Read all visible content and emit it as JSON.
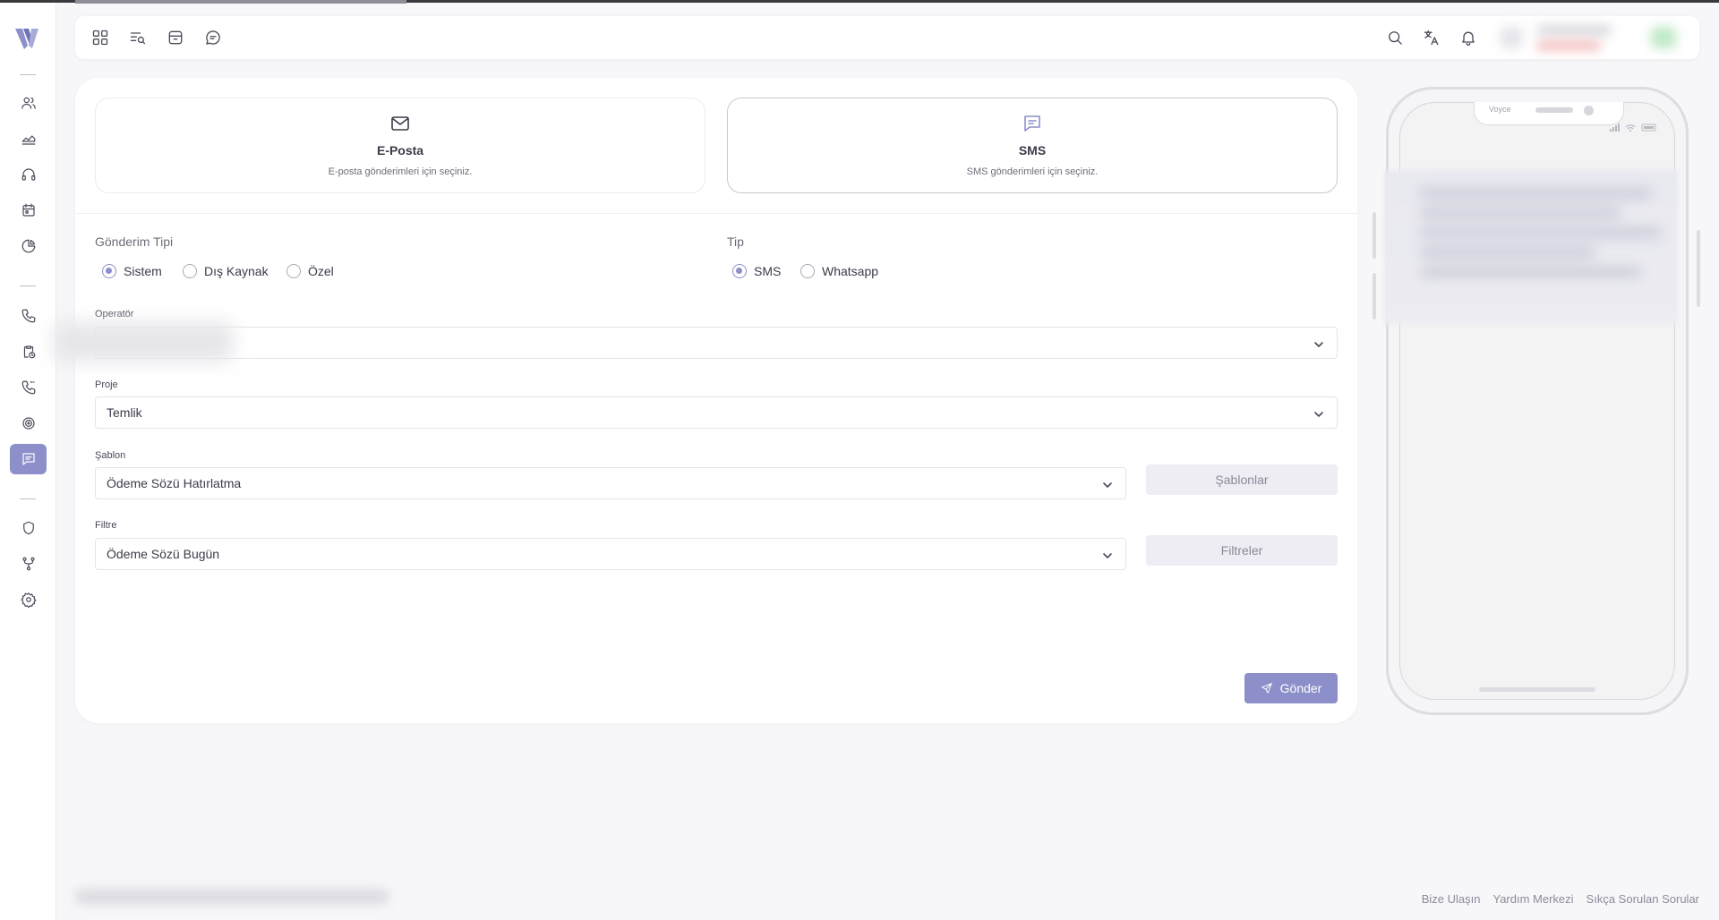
{
  "sidebar": {
    "active_item": "messages",
    "items": [
      "users",
      "dashboard",
      "support",
      "calendar",
      "reports",
      "calls",
      "tasks",
      "call-log",
      "targets",
      "messages",
      "security",
      "integrations",
      "settings"
    ]
  },
  "header": {
    "icons": [
      "grid-icon",
      "list-search-icon",
      "archive-icon",
      "chat-icon",
      "search-icon",
      "translate-icon",
      "bell-icon"
    ]
  },
  "channels": {
    "email": {
      "title": "E-Posta",
      "description": "E-posta gönderimleri için seçiniz."
    },
    "sms": {
      "title": "SMS",
      "description": "SMS gönderimleri için seçiniz.",
      "selected": true
    }
  },
  "send_type": {
    "label": "Gönderim Tipi",
    "options": [
      "Sistem",
      "Dış Kaynak",
      "Özel"
    ],
    "selected": "Sistem"
  },
  "type": {
    "label": "Tip",
    "options": [
      "SMS",
      "Whatsapp"
    ],
    "selected": "SMS"
  },
  "operator": {
    "label": "Operatör",
    "value": ""
  },
  "project": {
    "label": "Proje",
    "value": "Temlik"
  },
  "template": {
    "label": "Şablon",
    "value": "Ödeme Sözü Hatırlatma",
    "button": "Şablonlar"
  },
  "filter": {
    "label": "Filtre",
    "value": "Ödeme Sözü Bugün",
    "button": "Filtreler"
  },
  "send_button": "Gönder",
  "phone": {
    "brand": "Voyce"
  },
  "footer": {
    "links": [
      "Bize Ulaşın",
      "Yardım Merkezi",
      "Sıkça Sorulan Sorular"
    ]
  },
  "colors": {
    "accent": "#8c8fc9",
    "background": "#f7f7f9",
    "disabled_button": "#ededf3"
  }
}
